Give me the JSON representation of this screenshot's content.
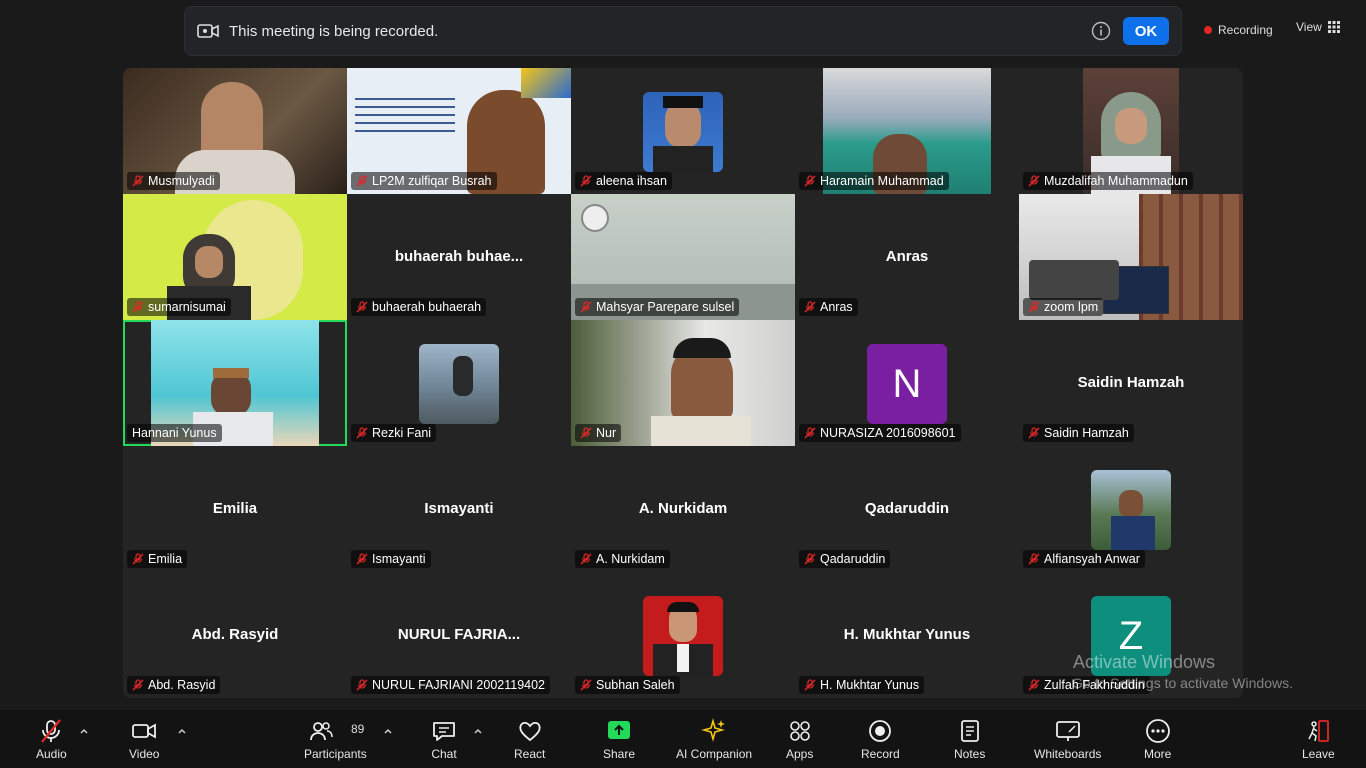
{
  "banner": {
    "message": "This meeting is being recorded.",
    "ok_label": "OK"
  },
  "recording": {
    "label": "Recording"
  },
  "view": {
    "label": "View"
  },
  "participants": [
    {
      "name": "Musmulyadi",
      "display": "",
      "video": true,
      "muted": true,
      "photo": "video-man-dark-room"
    },
    {
      "name": "LP2M zulfiqar Busrah",
      "display": "",
      "video": true,
      "muted": true,
      "photo": "video-seminar-background"
    },
    {
      "name": "aleena ihsan",
      "display": "",
      "video": false,
      "muted": true,
      "photo": "profile-man-peci"
    },
    {
      "name": "Haramain Muhammad",
      "display": "",
      "video": true,
      "muted": true,
      "photo": "video-man-green-wall"
    },
    {
      "name": "Muzdalifah Muhammadun",
      "display": "",
      "video": true,
      "muted": true,
      "photo": "video-woman-hijab"
    },
    {
      "name": "sumarnisumai",
      "display": "",
      "video": true,
      "muted": true,
      "photo": "video-woman-yellow-bg"
    },
    {
      "name": "buhaerah buhaerah",
      "display": "buhaerah  buhae...",
      "video": false,
      "muted": true,
      "photo": ""
    },
    {
      "name": "Mahsyar  Parepare sulsel",
      "display": "",
      "video": true,
      "muted": true,
      "photo": "video-room-clock"
    },
    {
      "name": "Anras",
      "display": "Anras",
      "video": false,
      "muted": true,
      "photo": ""
    },
    {
      "name": "zoom lpm",
      "display": "",
      "video": true,
      "muted": true,
      "photo": "video-meeting-room"
    },
    {
      "name": "Hannani Yunus",
      "display": "",
      "video": true,
      "muted": false,
      "active": true,
      "photo": "video-man-teal-room"
    },
    {
      "name": "Rezki Fani",
      "display": "",
      "video": false,
      "muted": true,
      "photo": "profile-woman-city"
    },
    {
      "name": "Nur",
      "display": "",
      "video": true,
      "muted": true,
      "photo": "video-man-office"
    },
    {
      "name": "NURASIZA 2016098601",
      "display": "",
      "video": false,
      "muted": true,
      "letter": "N",
      "letter_color": "#7b1fa2"
    },
    {
      "name": "Saidin Hamzah",
      "display": "Saidin Hamzah",
      "video": false,
      "muted": true,
      "photo": ""
    },
    {
      "name": "Emilia",
      "display": "Emilia",
      "video": false,
      "muted": true,
      "photo": ""
    },
    {
      "name": "Ismayanti",
      "display": "Ismayanti",
      "video": false,
      "muted": true,
      "photo": ""
    },
    {
      "name": "A. Nurkidam",
      "display": "A. Nurkidam",
      "video": false,
      "muted": true,
      "photo": ""
    },
    {
      "name": "Qadaruddin",
      "display": "Qadaruddin",
      "video": false,
      "muted": true,
      "photo": ""
    },
    {
      "name": "Alfiansyah Anwar",
      "display": "",
      "video": false,
      "muted": true,
      "photo": "profile-man-outdoor"
    },
    {
      "name": "Abd. Rasyid",
      "display": "Abd. Rasyid",
      "video": false,
      "muted": true,
      "photo": ""
    },
    {
      "name": "NURUL FAJRIANI 2002119402",
      "display": "NURUL FAJRIA...",
      "video": false,
      "muted": true,
      "photo": ""
    },
    {
      "name": "Subhan Saleh",
      "display": "",
      "video": false,
      "muted": true,
      "photo": "profile-man-red-bg"
    },
    {
      "name": "H. Mukhtar Yunus",
      "display": "H. Mukhtar Yunus",
      "video": false,
      "muted": true,
      "photo": ""
    },
    {
      "name": "Zulfah Fakhruddin",
      "display": "",
      "video": false,
      "muted": true,
      "letter": "Z",
      "letter_color": "#0e8f7e"
    }
  ],
  "watermark": {
    "line1": "Activate Windows",
    "line2": "Go to Settings to activate Windows."
  },
  "toolbar": {
    "audio": "Audio",
    "video": "Video",
    "participants": "Participants",
    "participants_count": "89",
    "chat": "Chat",
    "react": "React",
    "share": "Share",
    "ai_companion": "AI Companion",
    "apps": "Apps",
    "record": "Record",
    "notes": "Notes",
    "whiteboards": "Whiteboards",
    "more": "More",
    "leave": "Leave"
  },
  "colors": {
    "accent": "#0e71eb",
    "share": "#23d959",
    "recording_dot": "#e02828",
    "active_speaker": "#23d959"
  }
}
